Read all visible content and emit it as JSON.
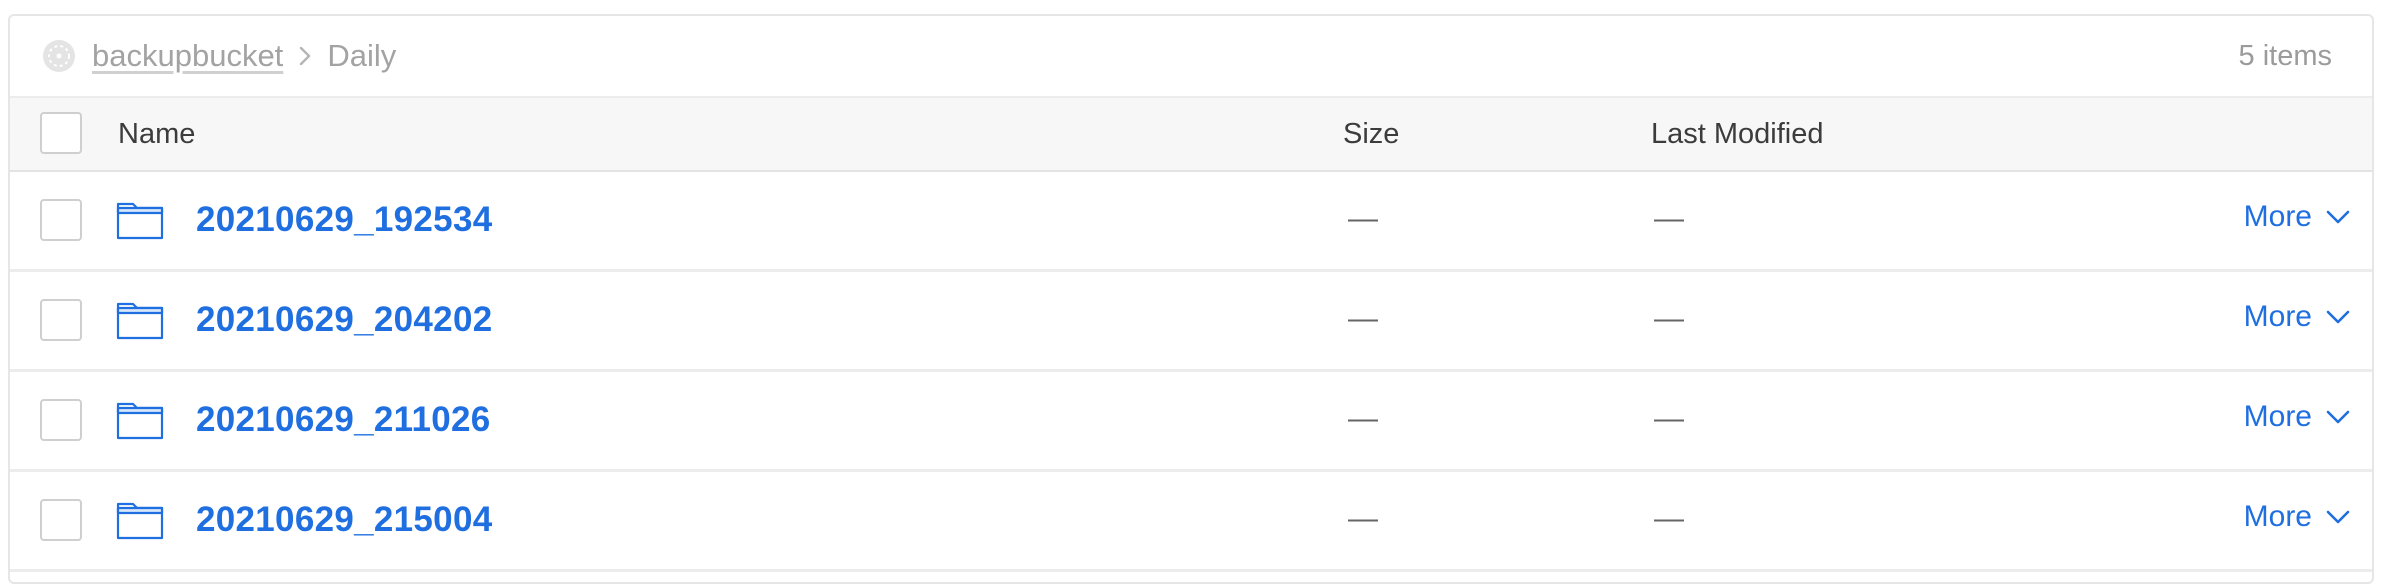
{
  "breadcrumb": {
    "bucket": "backupbucket",
    "current": "Daily"
  },
  "item_count": "5 items",
  "table": {
    "columns": {
      "name": "Name",
      "size": "Size",
      "last_modified": "Last Modified"
    },
    "rows": [
      {
        "name": "20210629_192534",
        "size": "—",
        "last_modified": "—",
        "action": "More"
      },
      {
        "name": "20210629_204202",
        "size": "—",
        "last_modified": "—",
        "action": "More"
      },
      {
        "name": "20210629_211026",
        "size": "—",
        "last_modified": "—",
        "action": "More"
      },
      {
        "name": "20210629_215004",
        "size": "—",
        "last_modified": "—",
        "action": "More"
      }
    ]
  },
  "icons": {
    "bucket": "bucket-icon",
    "separator": "chevron-right-icon",
    "folder": "folder-icon",
    "more": "chevron-down-icon"
  },
  "colors": {
    "link": "#1f6fe0",
    "muted_text": "#a3a3a3",
    "header_bg": "#f7f7f7",
    "border": "#e6e6e6"
  }
}
